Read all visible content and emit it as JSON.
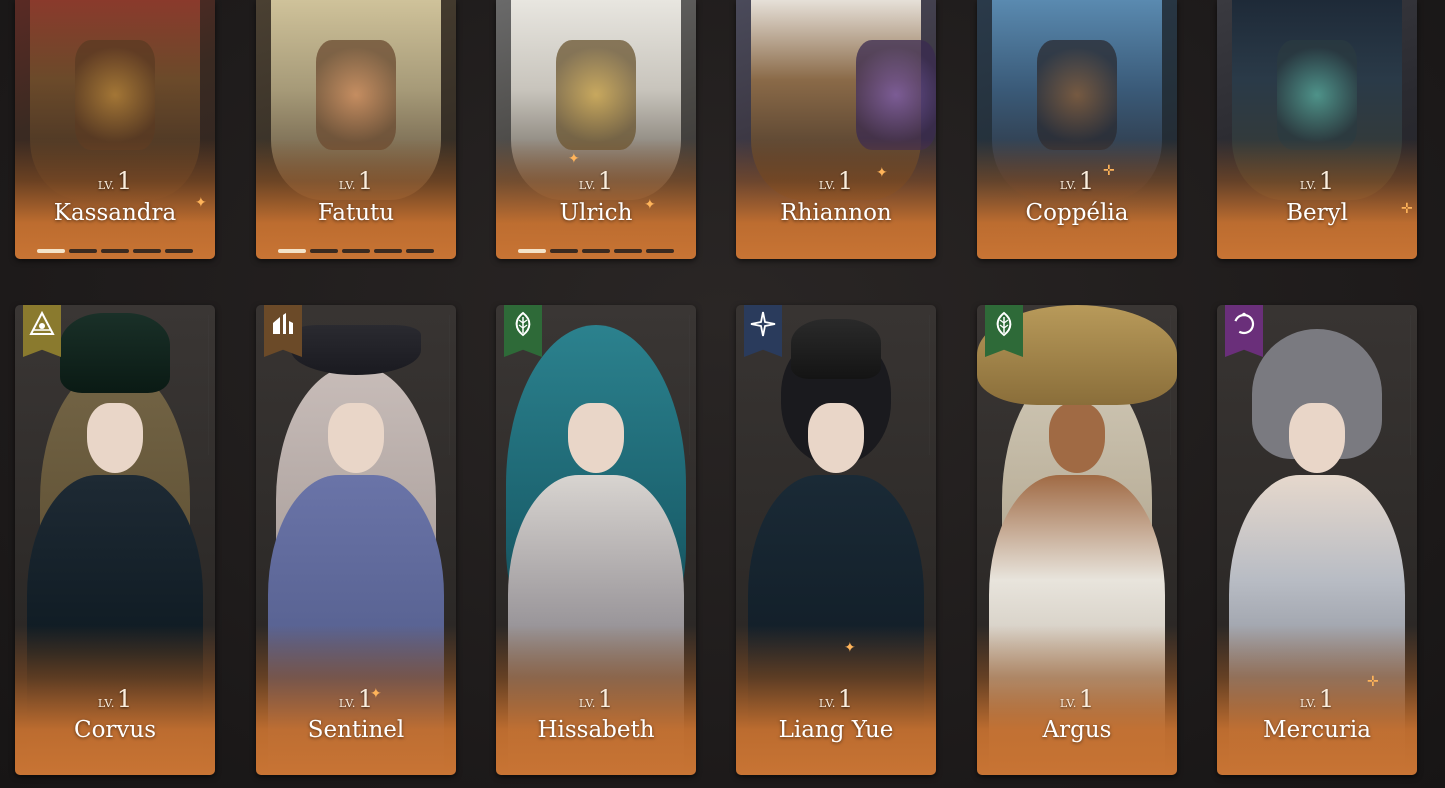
{
  "colors": {
    "card_gradient_bottom": "#c87434",
    "text_light": "#fbeede",
    "progress_on": "#f4e3c8",
    "progress_off": "#3a2a20",
    "badge_gold": "#8a7a2e",
    "badge_brown": "#6b4a28",
    "badge_green": "#2e6a38",
    "badge_navy": "#2a3b5c",
    "badge_purple": "#6a2f7a"
  },
  "level_label": "LV.",
  "row1": [
    {
      "name": "Kassandra",
      "level": "1",
      "progress_segments": 5,
      "progress_filled": 1
    },
    {
      "name": "Fatutu",
      "level": "1",
      "progress_segments": 5,
      "progress_filled": 1
    },
    {
      "name": "Ulrich",
      "level": "1",
      "progress_segments": 5,
      "progress_filled": 1
    },
    {
      "name": "Rhiannon",
      "level": "1"
    },
    {
      "name": "Coppélia",
      "level": "1"
    },
    {
      "name": "Beryl",
      "level": "1"
    }
  ],
  "row2": [
    {
      "name": "Corvus",
      "level": "1",
      "affinity_icon": "eye-pyramid-icon"
    },
    {
      "name": "Sentinel",
      "level": "1",
      "affinity_icon": "ruins-icon"
    },
    {
      "name": "Hissabeth",
      "level": "1",
      "affinity_icon": "leaf-icon"
    },
    {
      "name": "Liang Yue",
      "level": "1",
      "affinity_icon": "star-icon"
    },
    {
      "name": "Argus",
      "level": "1",
      "affinity_icon": "leaf-icon"
    },
    {
      "name": "Mercuria",
      "level": "1",
      "affinity_icon": "moon-ring-icon"
    }
  ]
}
